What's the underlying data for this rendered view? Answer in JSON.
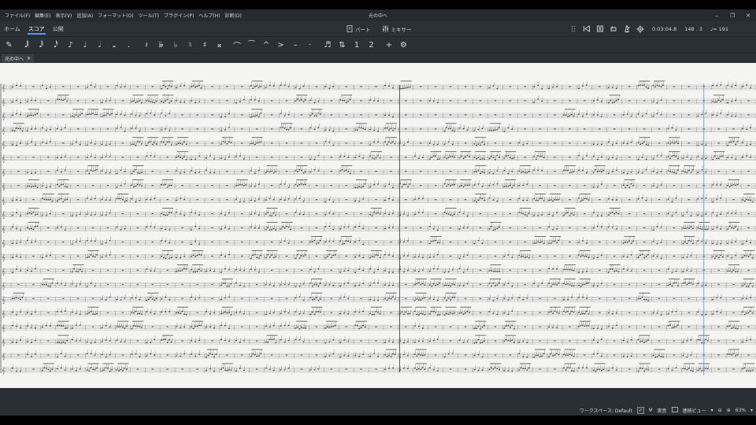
{
  "window": {
    "title": "光の中へ",
    "controls": [
      "–",
      "❐",
      "✕"
    ]
  },
  "menubar": [
    "ファイル(F)",
    "編集(E)",
    "表示(V)",
    "追加(A)",
    "フォーマット(O)",
    "ツール(T)",
    "プラグイン(P)",
    "ヘルプ(H)",
    "診断(D)"
  ],
  "toolbar": {
    "tabs": [
      "ホーム",
      "スコア",
      "公開"
    ],
    "active_tab": "スコア",
    "parts_label": "パート",
    "mixer_label": "ミキサー",
    "time_readout": "0:03:04.8",
    "position_readout": "148 . 3",
    "tempo_readout": "♩= 191"
  },
  "palette": {
    "items": [
      "pencil-icon",
      "64th-note",
      "32nd-note",
      "16th-note",
      "eighth-note",
      "quarter-note",
      "half-note",
      "whole-note",
      "dot",
      "rest",
      "double-flat",
      "flat",
      "natural",
      "sharp",
      "double-sharp",
      "tie",
      "slur",
      "marcato",
      "accent",
      "tenuto",
      "staccato",
      "tuplet",
      "flip",
      "voice-1",
      "voice-2",
      "add",
      "settings"
    ],
    "glyphs": [
      "✎",
      "𝅘𝅥𝅲",
      "𝅘𝅥𝅱",
      "𝅘𝅥𝅰",
      "♪",
      "♩",
      "𝅗𝅥",
      "𝅝",
      ".",
      "𝄽",
      "𝄫",
      "♭",
      "♮",
      "♯",
      "𝄪",
      "⌒",
      "⁀",
      "^",
      ">",
      "–",
      "·",
      "♬",
      "⇅",
      "1",
      "2",
      "+",
      "⚙"
    ]
  },
  "document_tab": {
    "label": "光の中へ",
    "close": "✕"
  },
  "statusbar": {
    "workspace_label": "ワークスペース: Default",
    "concert_pitch_label": "実音",
    "view_mode_label": "連続ビュー",
    "zoom_label": "63%"
  },
  "colors": {
    "accent": "#4a9fe8",
    "chrome_bg": "#2b2f36",
    "score_bg": "#f4f4f3",
    "playback_cursor": "#5b8fd8"
  },
  "score": {
    "staff_count": 21,
    "measure_count": 50
  }
}
